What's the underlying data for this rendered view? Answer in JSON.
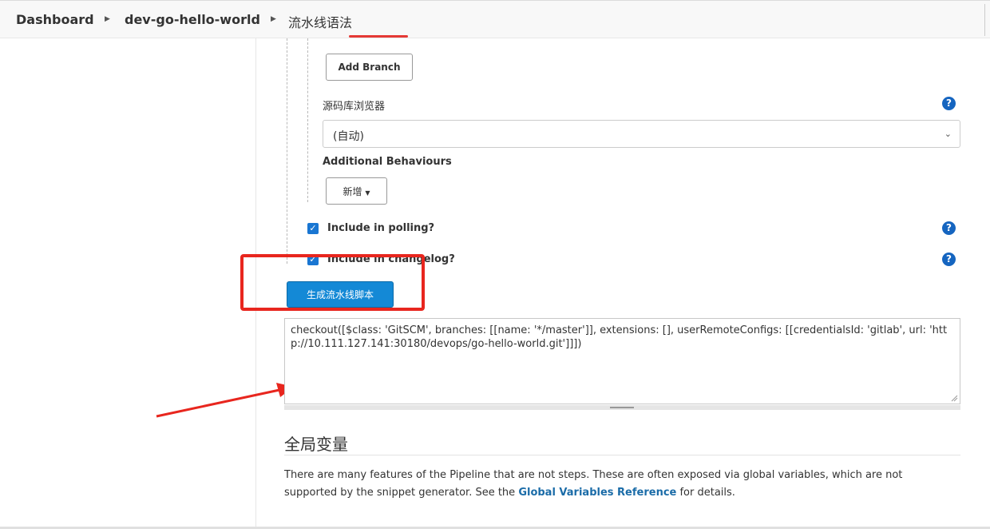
{
  "breadcrumb": {
    "items": [
      {
        "label": "Dashboard"
      },
      {
        "label": "dev-go-hello-world"
      },
      {
        "label": "流水线语法"
      }
    ]
  },
  "form": {
    "add_branch_label": "Add Branch",
    "repo_browser_label": "源码库浏览器",
    "repo_browser_value": "(自动)",
    "additional_behaviours_label": "Additional Behaviours",
    "add_dropdown_label": "新增",
    "include_polling_label": "Include in polling?",
    "include_changelog_label": "Include in changelog?",
    "help_symbol": "?",
    "generate_button_label": "生成流水线脚本"
  },
  "snippet": {
    "code": "checkout([$class: 'GitSCM', branches: [[name: '*/master']], extensions: [], userRemoteConfigs: [[credentialsId: 'gitlab', url: 'http://10.111.127.141:30180/devops/go-hello-world.git']]])"
  },
  "global_vars": {
    "title": "全局变量",
    "desc_before": "There are many features of the Pipeline that are not steps. These are often exposed via global variables, which are not supported by the snippet generator. See the ",
    "link_label": "Global Variables Reference",
    "desc_after": " for details."
  },
  "colors": {
    "accent": "#1489d6",
    "annotation_red": "#e8261e",
    "help_blue": "#1565c0"
  },
  "icons": {
    "breadcrumb_separator": "caret-right-icon",
    "select_chevron": "chevron-down-icon",
    "help": "help-circle-icon",
    "checkbox": "checkbox-checked-icon"
  }
}
